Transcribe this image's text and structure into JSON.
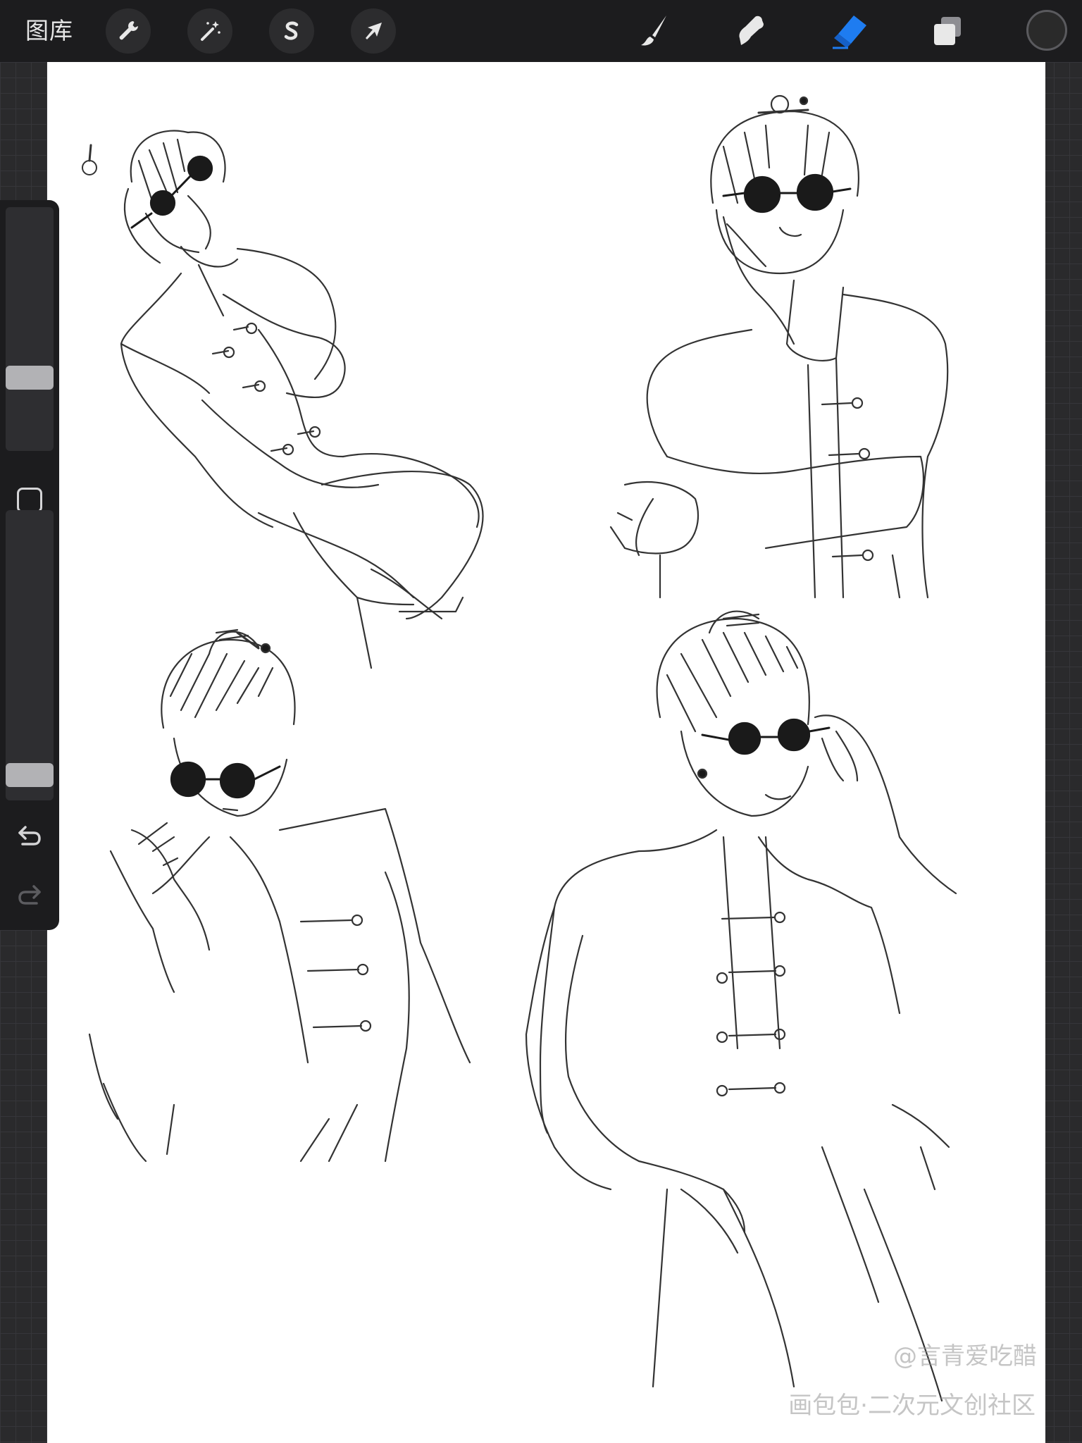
{
  "toolbar": {
    "gallery_label": "图库",
    "left_tools": [
      "wrench-icon",
      "magic-wand-icon",
      "selection-s-icon",
      "arrow-transform-icon"
    ],
    "right_tools": [
      "brush-icon",
      "smudge-icon",
      "eraser-icon",
      "layers-icon"
    ],
    "active_tool": "eraser",
    "accent_color": "#1e7cf0",
    "current_color": "#2a2a2a"
  },
  "sidebar": {
    "size_slider_value": 0.28,
    "opacity_slider_value": 0.05,
    "icons": [
      "modify-square-icon",
      "undo-icon",
      "redo-icon"
    ]
  },
  "canvas": {
    "background": "#ffffff",
    "content": "pencil sketch artwork",
    "watermark_author": "@言青爱吃醋",
    "watermark_site": "画包包·二次元文创社区"
  }
}
